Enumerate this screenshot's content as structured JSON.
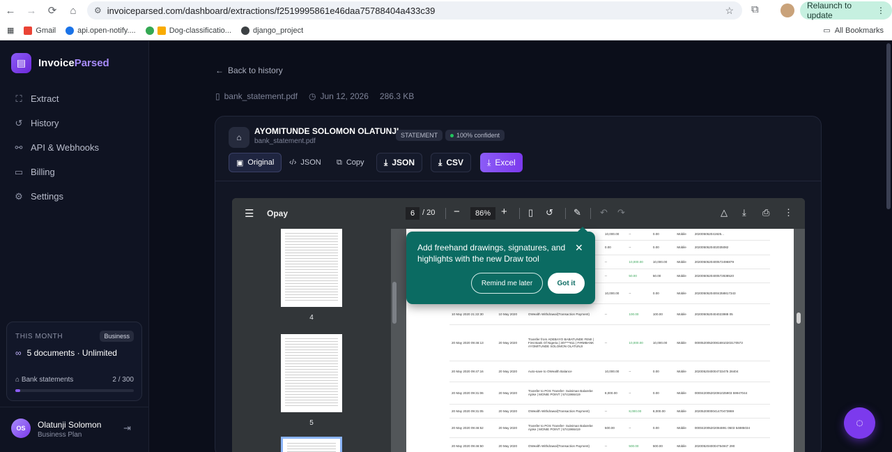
{
  "browser": {
    "url": "invoiceparsed.com/dashboard/extractions/f2519995861e46daa75788404a433c39",
    "relaunch": "Relaunch to update",
    "bookmarks": [
      "Gmail",
      "api.open-notify....",
      "Dog-classificatio...",
      "django_project"
    ],
    "all_bookmarks": "All Bookmarks"
  },
  "brand": {
    "name_a": "Invoice",
    "name_b": "Parsed"
  },
  "nav": [
    {
      "label": "Extract",
      "icon": "scan-icon"
    },
    {
      "label": "History",
      "icon": "history-icon"
    },
    {
      "label": "API & Webhooks",
      "icon": "code-icon"
    },
    {
      "label": "Billing",
      "icon": "card-icon"
    },
    {
      "label": "Settings",
      "icon": "gear-icon"
    }
  ],
  "usage": {
    "label": "THIS MONTH",
    "badge": "Business",
    "main": "5 documents · Unlimited",
    "sub_label": "Bank statements",
    "sub_value": "2 / 300",
    "progress": 0.0067
  },
  "user": {
    "initials": "OS",
    "name": "Olatunji Solomon",
    "plan": "Business Plan"
  },
  "back": "Back to history",
  "file": {
    "name": "bank_statement.pdf",
    "date": "Jun 12, 2026",
    "size": "286.3 KB"
  },
  "doc": {
    "title": "AYOMITUNDE SOLOMON OLATUNJI",
    "filename": "bank_statement.pdf",
    "type_tag": "STATEMENT",
    "confidence": "100% confident"
  },
  "toolbar": {
    "original": "Original",
    "json_view": "JSON",
    "copy": "Copy",
    "json_dl": "JSON",
    "csv_dl": "CSV",
    "excel_dl": "Excel"
  },
  "pdf": {
    "title": "Opay",
    "page": "6",
    "total": "/ 20",
    "zoom": "86%",
    "thumbs": [
      "4",
      "5"
    ]
  },
  "statement_rows": [
    [
      "10 May 2020 ...",
      "10 May 2020",
      "",
      "10,000.00",
      "--",
      "0.00",
      "Mobile",
      "202005052041925..."
    ],
    [
      "",
      "",
      "",
      "0.00",
      "--",
      "0.00",
      "Mobile",
      "2020050520402035082"
    ],
    [
      "",
      "",
      "",
      "--",
      "10,000.00",
      "10,000.00",
      "Mobile",
      "2020050520400572496879"
    ],
    [
      "",
      "",
      "",
      "--",
      "50.00",
      "50.00",
      "Mobile",
      "2020050520400572838520"
    ],
    [
      "",
      "",
      "",
      "10,000.00",
      "--",
      "0.00",
      "Mobile",
      "20200505204004358817343"
    ],
    [
      "10 May 2020 21:22:30",
      "10 May 2020",
      "OWealth Withdrawal(Transaction Payment)",
      "--",
      "100.00",
      "100.00",
      "Mobile",
      "2020050520404023988 05"
    ],
    [
      "20 May 2020 09:46:13",
      "20 May 2020",
      "Transfer from ADEBAYO BABATUNDE FEMI | First Bank Of Nigeria | 307***911 | FIRMBANK AYOMITUNDE SOLOMON OLATUNJI",
      "--",
      "10,000.00",
      "10,000.00",
      "Mobile",
      "000052005200816910203170573"
    ],
    [
      "20 May 2020 09:47:16",
      "20 May 2020",
      "Auto-save to OWealth Balance",
      "10,000.00",
      "--",
      "0.00",
      "Mobile",
      "2020052040004733475 28404"
    ],
    [
      "20 May 2020 09:31:06",
      "20 May 2020",
      "Transfer to POS Transfer- Suleiman Balarebe Ajoke | MONIE POINT | 5741966419",
      "8,000.00",
      "--",
      "0.00",
      "Mobile",
      "000042005202081025903 59947044"
    ],
    [
      "20 May 2020 09:31:05",
      "20 May 2020",
      "OWealth Withdrawal(Transaction Payment)",
      "--",
      "8,000.00",
      "8,000.00",
      "Mobile",
      "2020520000041470473869"
    ],
    [
      "20 May 2020 09:46:52",
      "20 May 2020",
      "Transfer to POS Transfer- Suleiman Balarebe Ajoke | MONIE POINT | 5741966419",
      "500.00",
      "--",
      "0.00",
      "Mobile",
      "000042005202084891 0503 54885034"
    ],
    [
      "20 May 2020 09:46:50",
      "20 May 2020",
      "OWealth Withdrawal(Transaction Payment)",
      "--",
      "500.00",
      "500.00",
      "Mobile",
      "2020052040004754947 290"
    ]
  ],
  "tip": {
    "text": "Add freehand drawings, signatures, and highlights with the new Draw tool",
    "later": "Remind me later",
    "got": "Got it"
  }
}
